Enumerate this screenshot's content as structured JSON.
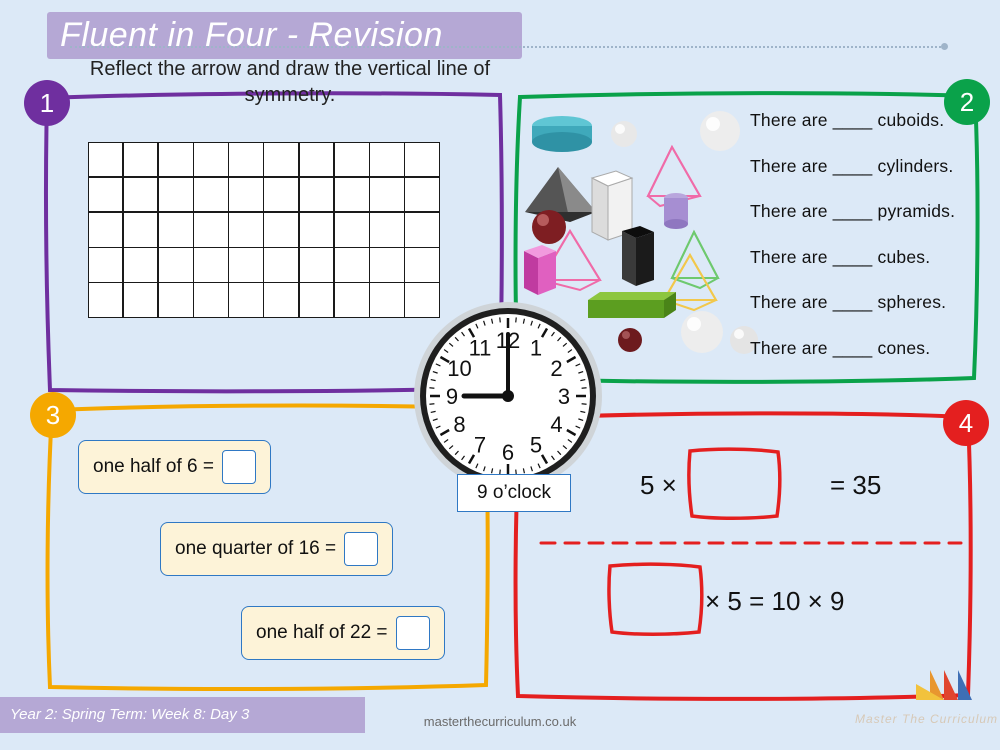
{
  "header": {
    "title": "Fluent in Four - Revision",
    "instruction": "Reflect the arrow and draw the vertical line of symmetry."
  },
  "questions": {
    "q1": {
      "number": "1",
      "grid_cols": 10,
      "grid_rows": 5,
      "arrow_direction": "left",
      "arrow_color": "#ec3b93"
    },
    "q2": {
      "number": "2",
      "lines": [
        "There are ____ cuboids.",
        "There are ____ cylinders.",
        "There are ____ pyramids.",
        "There are ____ cubes.",
        "There are ____ spheres.",
        "There are ____ cones."
      ]
    },
    "q3": {
      "number": "3",
      "items": [
        {
          "label": "one half of 6 =",
          "answer": ""
        },
        {
          "label": "one quarter of 16 =",
          "answer": ""
        },
        {
          "label": "one half of 22 =",
          "answer": ""
        }
      ]
    },
    "q4": {
      "number": "4",
      "line1_left": "5 ×",
      "line1_right": "= 35",
      "line2_right": "× 5 = 10 × 9"
    }
  },
  "clock": {
    "numerals": [
      "12",
      "1",
      "2",
      "3",
      "4",
      "5",
      "6",
      "7",
      "8",
      "9",
      "10",
      "11"
    ],
    "time_label": "9 o’clock",
    "hour_hand": 9,
    "minute_hand": 0
  },
  "footer": {
    "lesson": "Year 2: Spring Term: Week 8: Day 3",
    "website": "masterthecurriculum.co.uk",
    "brand": "Master The Curriculum"
  },
  "colors": {
    "q1": "#6f2f9f",
    "q2": "#0aa24a",
    "q3": "#f5a800",
    "q4": "#e41f1f",
    "band": "#b5a8d5",
    "background": "#dce9f7"
  }
}
